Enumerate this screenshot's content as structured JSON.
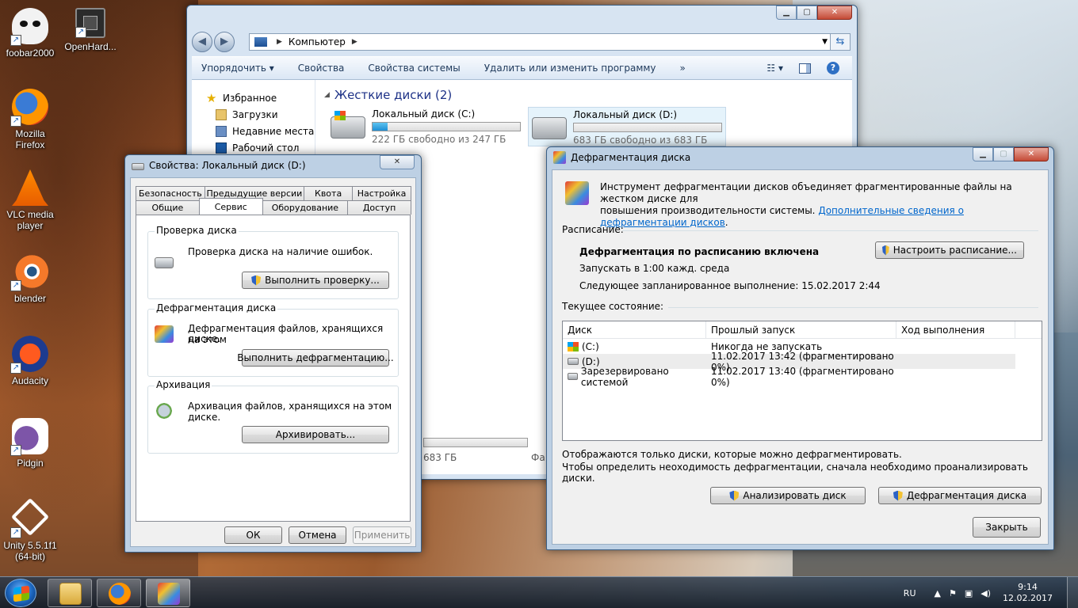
{
  "desktop": {
    "icons": [
      {
        "label": "foobar2000",
        "icon": "foobar-cat-icon"
      },
      {
        "label": "OpenHard...",
        "icon": "chip-icon"
      },
      {
        "label": "Mozilla Firefox",
        "icon": "firefox-icon"
      },
      {
        "label": "VLC media player",
        "icon": "vlc-cone-icon"
      },
      {
        "label": "blender",
        "icon": "blender-icon"
      },
      {
        "label": "Audacity",
        "icon": "audacity-icon"
      },
      {
        "label": "Pidgin",
        "icon": "pidgin-icon"
      },
      {
        "label": "Unity 5.5.1f1 (64-bit)",
        "icon": "unity-icon"
      }
    ]
  },
  "explorer": {
    "address": "Компьютер",
    "toolbar": {
      "organize": "Упорядочить",
      "properties": "Свойства",
      "system_properties": "Свойства системы",
      "uninstall": "Удалить или изменить программу",
      "more": "»"
    },
    "nav": {
      "favorites": "Избранное",
      "downloads": "Загрузки",
      "recent": "Недавние места",
      "desktop": "Рабочий стол"
    },
    "group_title": "Жесткие диски (2)",
    "drives": [
      {
        "name": "Локальный диск (C:)",
        "free": "222 ГБ свободно из 247 ГБ",
        "used_fraction": 0.1
      },
      {
        "name": "Локальный диск (D:)",
        "free": "683 ГБ свободно из 683 ГБ",
        "used_fraction": 0.0
      }
    ],
    "partial_size": "683 ГБ",
    "partial_label": "Фа"
  },
  "props": {
    "title": "Свойства: Локальный диск (D:)",
    "tabs_row1": [
      "Безопасность",
      "Предыдущие версии",
      "Квота",
      "Настройка"
    ],
    "tabs_row2": [
      "Общие",
      "Сервис",
      "Оборудование",
      "Доступ"
    ],
    "check": {
      "title": "Проверка диска",
      "text": "Проверка диска на наличие ошибок.",
      "button": "Выполнить проверку..."
    },
    "defrag": {
      "title": "Дефрагментация диска",
      "text1": "Дефрагментация файлов, хранящихся на этом",
      "text2": "диске.",
      "button": "Выполнить дефрагментацию..."
    },
    "backup": {
      "title": "Архивация",
      "text": "Архивация файлов, хранящихся на этом диске.",
      "button": "Архивировать..."
    },
    "ok": "ОК",
    "cancel": "Отмена",
    "apply": "Применить"
  },
  "defrag": {
    "title": "Дефрагментация диска",
    "intro1": "Инструмент дефрагментации дисков объединяет фрагментированные файлы на жестком диске для",
    "intro2": "повышения производительности системы.",
    "intro_link": "Дополнительные сведения о дефрагментации дисков",
    "intro_end": ".",
    "schedule_label": "Расписание:",
    "schedule_on": "Дефрагментация по расписанию включена",
    "schedule_run": "Запускать в 1:00 кажд. среда",
    "schedule_next": "Следующее запланированное выполнение: 15.02.2017 2:44",
    "configure_button": "Настроить расписание...",
    "status_label": "Текущее состояние:",
    "columns": [
      "Диск",
      "Прошлый запуск",
      "Ход выполнения"
    ],
    "rows": [
      {
        "disk": "(C:)",
        "last": "Никогда не запускать"
      },
      {
        "disk": "(D:)",
        "last": "11.02.2017 13:42 (фрагментировано 0%)"
      },
      {
        "disk": "Зарезервировано системой",
        "last": "11.02.2017 13:40 (фрагментировано 0%)"
      }
    ],
    "note1": "Отображаются только диски, которые можно дефрагментировать.",
    "note2": "Чтобы определить неоходимость  дефрагментации, сначала необходимо проанализировать диски.",
    "analyze_button": "Анализировать диск",
    "defrag_button": "Дефрагментация диска",
    "close_button": "Закрыть"
  },
  "taskbar": {
    "lang": "RU",
    "time": "9:14",
    "date": "12.02.2017"
  }
}
